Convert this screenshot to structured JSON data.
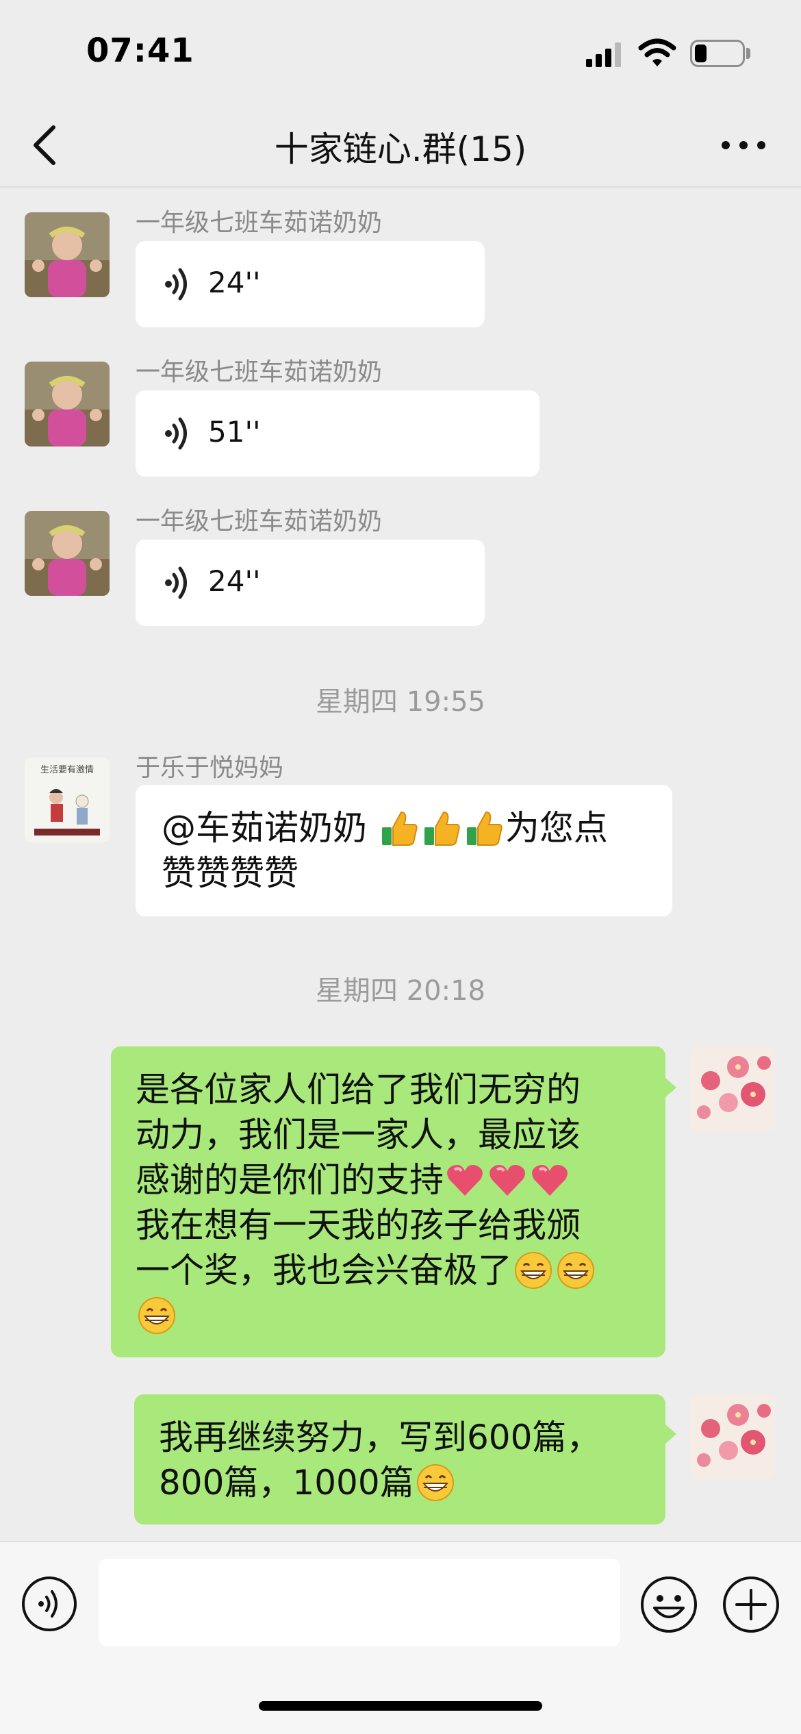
{
  "status_bar": {
    "time": "07:41",
    "battery_level": 0.25
  },
  "nav": {
    "title": "十家链心.群(15)"
  },
  "messages": [
    {
      "type": "voice",
      "sender": "一年级七班车茹诺奶奶",
      "duration": "24''"
    },
    {
      "type": "voice",
      "sender": "一年级七班车茹诺奶奶",
      "duration": "51''"
    },
    {
      "type": "voice",
      "sender": "一年级七班车茹诺奶奶",
      "duration": "24''"
    },
    {
      "type": "time",
      "text": "星期四 19:55"
    },
    {
      "type": "text",
      "sender": "于乐于悦妈妈",
      "line1_a": "@车茹诺奶奶 ",
      "line1_b": "为您点",
      "line2": "赞赞赞赞",
      "emojis": [
        "thumbs-up",
        "thumbs-up",
        "thumbs-up"
      ]
    },
    {
      "type": "time",
      "text": "星期四 20:18"
    },
    {
      "type": "text",
      "direction": "out",
      "line1": "是各位家人们给了我们无穷的",
      "line2": "动力，我们是一家人，最应该",
      "line3": "感谢的是你们的支持",
      "line4": "我在想有一天我的孩子给我颁",
      "line5": "一个奖，我也会兴奋极了",
      "emojis": [
        "heart",
        "heart",
        "heart",
        "grin",
        "grin",
        "grin"
      ]
    },
    {
      "type": "text",
      "direction": "out",
      "line1": "我再继续努力，写到600篇，",
      "line2": "800篇，1000篇",
      "emojis": [
        "grin"
      ]
    }
  ],
  "input_bar": {
    "placeholder": "",
    "value": ""
  },
  "colors": {
    "background": "#ededed",
    "outgoing_bubble": "#a9e87a",
    "incoming_bubble": "#ffffff",
    "timestamp": "#9b9b9b",
    "sender_name": "#8a8a8a"
  },
  "icons": [
    "back-chevron-icon",
    "more-dots-icon",
    "voice-wave-icon",
    "voice-mode-icon",
    "emoji-face-icon",
    "add-plus-icon",
    "thumbs-up-emoji",
    "heart-emoji",
    "grin-emoji"
  ]
}
